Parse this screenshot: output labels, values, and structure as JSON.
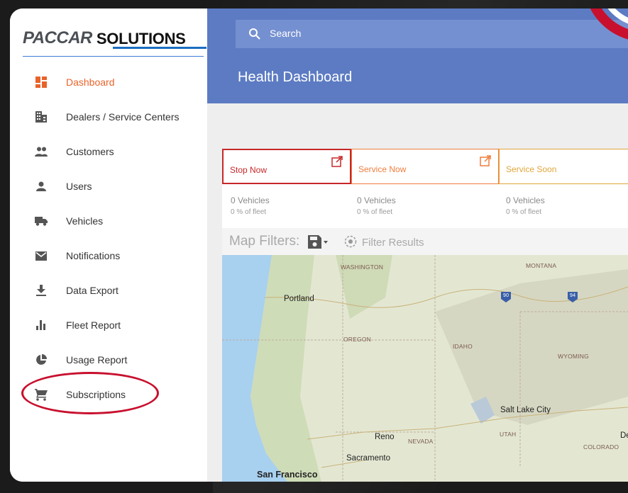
{
  "logo": {
    "brand": "PACCAR",
    "product": "SOLUTIONS"
  },
  "sidebar": {
    "items": [
      {
        "label": "Dashboard",
        "icon": "dashboard-icon",
        "active": true
      },
      {
        "label": "Dealers / Service Centers",
        "icon": "building-icon",
        "active": false
      },
      {
        "label": "Customers",
        "icon": "people-icon",
        "active": false
      },
      {
        "label": "Users",
        "icon": "person-icon",
        "active": false
      },
      {
        "label": "Vehicles",
        "icon": "truck-icon",
        "active": false
      },
      {
        "label": "Notifications",
        "icon": "envelope-icon",
        "active": false
      },
      {
        "label": "Data Export",
        "icon": "download-icon",
        "active": false
      },
      {
        "label": "Fleet Report",
        "icon": "bar-chart-icon",
        "active": false
      },
      {
        "label": "Usage Report",
        "icon": "pie-chart-icon",
        "active": false
      },
      {
        "label": "Subscriptions",
        "icon": "cart-icon",
        "active": false,
        "highlighted": true
      }
    ]
  },
  "search": {
    "placeholder": "Search"
  },
  "header": {
    "title": "Health Dashboard"
  },
  "status_cards": [
    {
      "title": "Stop Now",
      "color": "#c62828",
      "vehicles": "0 Vehicles",
      "fleet": "0 % of fleet"
    },
    {
      "title": "Service Now",
      "color": "#ef7d3c",
      "vehicles": "0 Vehicles",
      "fleet": "0 % of fleet"
    },
    {
      "title": "Service Soon",
      "color": "#e0a63a",
      "vehicles": "0 Vehicles",
      "fleet": "0 % of fleet"
    }
  ],
  "map_filters": {
    "label": "Map Filters:",
    "filter_results": "Filter Results"
  },
  "map": {
    "states": [
      "WASHINGTON",
      "MONTANA",
      "OREGON",
      "IDAHO",
      "WYOMING",
      "NEVADA",
      "UTAH",
      "COLORADO"
    ],
    "cities": [
      "Portland",
      "Salt Lake City",
      "Reno",
      "Sacramento",
      "San Francisco",
      "De"
    ],
    "highways": [
      "90",
      "94"
    ]
  },
  "colors": {
    "accent": "#e8632b",
    "header_blue": "#5c7bc3",
    "highlight_ring": "#c8102e"
  }
}
